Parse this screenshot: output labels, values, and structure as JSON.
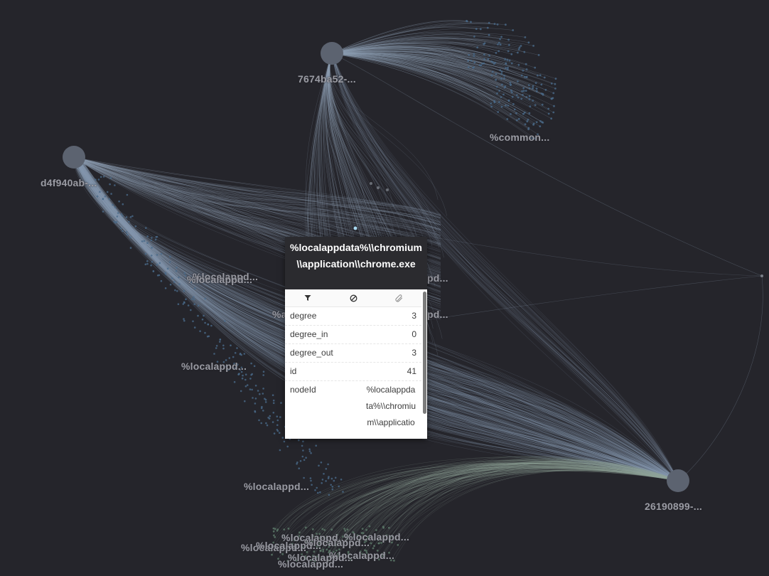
{
  "graph": {
    "labels": {
      "hub_top": "7674ba52-...",
      "hub_left": "d4f940ab-...",
      "hub_bottom_right": "26190899-...",
      "common": "%common...",
      "localappd_1": "%localappd...",
      "localappd_2": "%localappd...",
      "localappd_3": "%localappd...",
      "localappd_4": "%localappd...",
      "localappd_5": "%localappd...",
      "localappd_6": "%localappd...",
      "localappd_7": "%localappd...",
      "localappd_partial_1": "pd...",
      "localappd_partial_2": "pd...",
      "localappd_partial_3": "%a",
      "cluster_1": "%localappd...",
      "cluster_2": "%localappd...",
      "cluster_3": "%localappd...",
      "cluster_4": "%localappd...",
      "cluster_5": "%localappd...",
      "cluster_6": "%localappd...",
      "cluster_7": "%localappd...",
      "cluster_8": "%localappd..."
    },
    "colors": {
      "background": "#25252b",
      "edge": "#8a9bb0",
      "node": "#5c6370",
      "node_dots": "#4a6a8a",
      "node_dots_green": "#5d7a6a"
    }
  },
  "tooltip": {
    "title": "%localappdata%\\\\chromium\\\\application\\\\chrome.exe",
    "toolbar": {
      "filter_icon": "filter-icon",
      "hide_icon": "hide-icon",
      "pin_icon": "pin-icon"
    },
    "properties": {
      "degree_key": "degree",
      "degree_val": "3",
      "degree_in_key": "degree_in",
      "degree_in_val": "0",
      "degree_out_key": "degree_out",
      "degree_out_val": "3",
      "id_key": "id",
      "id_val": "41",
      "nodeid_key": "nodeId",
      "nodeid_val": "%localappdata%\\\\chromium\\\\application\\\\chrome.exe"
    }
  }
}
